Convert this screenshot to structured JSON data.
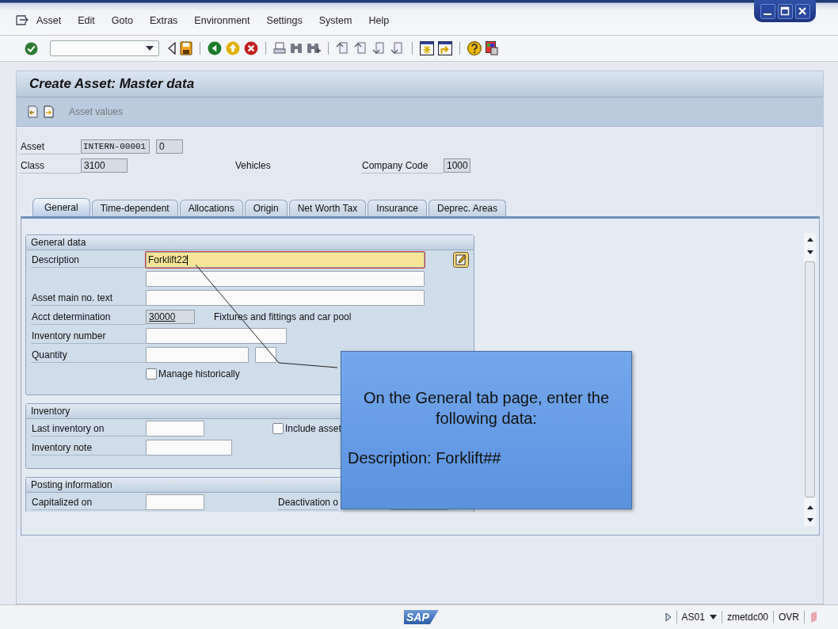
{
  "menu_bar": {
    "items": [
      "Asset",
      "Edit",
      "Goto",
      "Extras",
      "Environment",
      "Settings",
      "System",
      "Help"
    ]
  },
  "screen": {
    "title": "Create Asset: Master data",
    "app_toolbar": {
      "button": "Asset values"
    }
  },
  "header": {
    "asset": {
      "label": "Asset",
      "value": "INTERN-00001",
      "sub_number": "0"
    },
    "class": {
      "label": "Class",
      "value": "3100",
      "description": "Vehicles"
    },
    "company_code": {
      "label": "Company Code",
      "value": "1000"
    }
  },
  "tabs": [
    {
      "label": "General",
      "selected": true
    },
    {
      "label": "Time-dependent",
      "selected": false
    },
    {
      "label": "Allocations",
      "selected": false
    },
    {
      "label": "Origin",
      "selected": false
    },
    {
      "label": "Net Worth Tax",
      "selected": false
    },
    {
      "label": "Insurance",
      "selected": false
    },
    {
      "label": "Deprec. Areas",
      "selected": false
    }
  ],
  "general_data": {
    "title": "General data",
    "description": {
      "label": "Description",
      "value": "Forklift22",
      "focused": true
    },
    "main_no_text": {
      "label": "Asset main no. text"
    },
    "acct_determination": {
      "label": "Acct determination",
      "value": "30000",
      "text": "Fixtures and fittings and car pool"
    },
    "inventory_number": {
      "label": "Inventory number"
    },
    "quantity": {
      "label": "Quantity"
    },
    "manage_historically": {
      "label": "Manage historically",
      "checked": false
    }
  },
  "inventory": {
    "title": "Inventory",
    "last_inventory_on": {
      "label": "Last inventory on"
    },
    "include_asset": {
      "label": "Include asset",
      "checked": false
    },
    "inventory_note": {
      "label": "Inventory note"
    }
  },
  "posting": {
    "title": "Posting information",
    "capitalized_on": {
      "label": "Capitalized on"
    },
    "deactivation_on": {
      "label": "Deactivation o"
    }
  },
  "callout": {
    "instruction": "On the General tab page, enter the following data:",
    "detail": "Description: Forklift##"
  },
  "status_bar": {
    "logo": "SAP",
    "transaction": "AS01",
    "server": "zmetdc00",
    "mode": "OVR"
  }
}
